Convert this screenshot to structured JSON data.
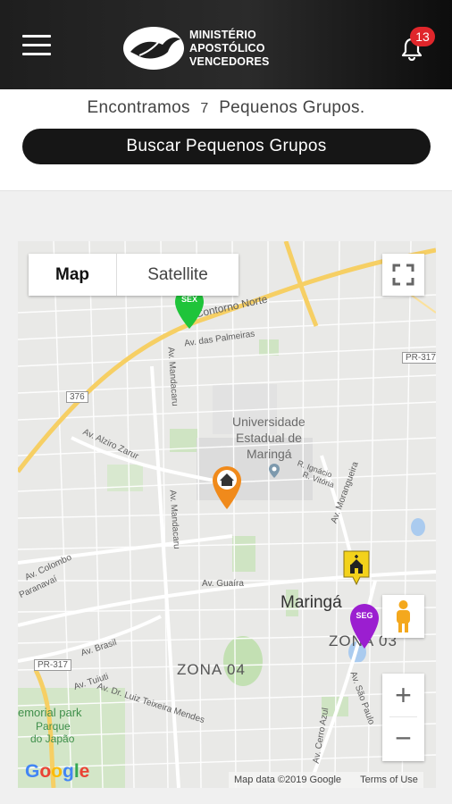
{
  "header": {
    "menu_icon": "hamburger-menu-icon",
    "logo_lines": [
      "MINISTÉRIO",
      "APOSTÓLICO",
      "VENCEDORES"
    ],
    "notification_icon": "bell-icon",
    "notification_count": "13",
    "colors": {
      "bar": "#1e1e1e",
      "badge": "#e0262b"
    }
  },
  "results": {
    "prefix": "Encontramos",
    "count": "7",
    "suffix": "Pequenos Grupos.",
    "search_button_label": "Buscar Pequenos Grupos"
  },
  "map": {
    "type_buttons": {
      "map": "Map",
      "satellite": "Satellite"
    },
    "controls": {
      "fullscreen_icon": "fullscreen-icon",
      "pegman_icon": "pegman-icon",
      "zoom_in": "+",
      "zoom_out": "−"
    },
    "markers": [
      {
        "label": "SEX",
        "color": "#1fc43a"
      },
      {
        "label": "",
        "icon": "home-icon",
        "color": "#f08a1b"
      },
      {
        "label": "",
        "icon": "church-icon",
        "color": "#f3d21b"
      },
      {
        "label": "SEG",
        "color": "#9b1ed0"
      }
    ],
    "labels": {
      "contorno_norte": "Contorno Norte",
      "palmeiras": "Av. das Palmeiras",
      "pr317_top": "PR-317",
      "route376": "376",
      "univ1": "Universidade",
      "univ2": "Estadual de",
      "univ3": "Maringá",
      "alziro": "Av. Alziro Zarur",
      "ignacio": "R. Ignácio",
      "vitoria": "R. Vitória",
      "mandacaru1": "Av. Mandacaru",
      "mandacaru2": "Av. Mandacaru",
      "morangueira": "Av. Morangueira",
      "colombo": "Av. Colombo",
      "paranavai": "Paranavaí",
      "guaira": "Av. Guaíra",
      "city": "Maringá",
      "zona03": "ZONA 03",
      "zona04": "ZONA 04",
      "brasil": "Av. Brasil",
      "pr317_bottom": "PR-317",
      "tuiuti": "Av. Tuiuti",
      "luiz_teixeira": "Av. Dr. Luiz Teixeira Mendes",
      "sao_paulo": "Av. São Paulo",
      "cerro_azul": "Av. Cerro Azul",
      "memorial_park": "emorial park",
      "parque1": "Parque",
      "parque2": "do Japão"
    },
    "attribution": {
      "data": "Map data ©2019 Google",
      "terms": "Terms of Use"
    },
    "google_logo": "Google"
  }
}
